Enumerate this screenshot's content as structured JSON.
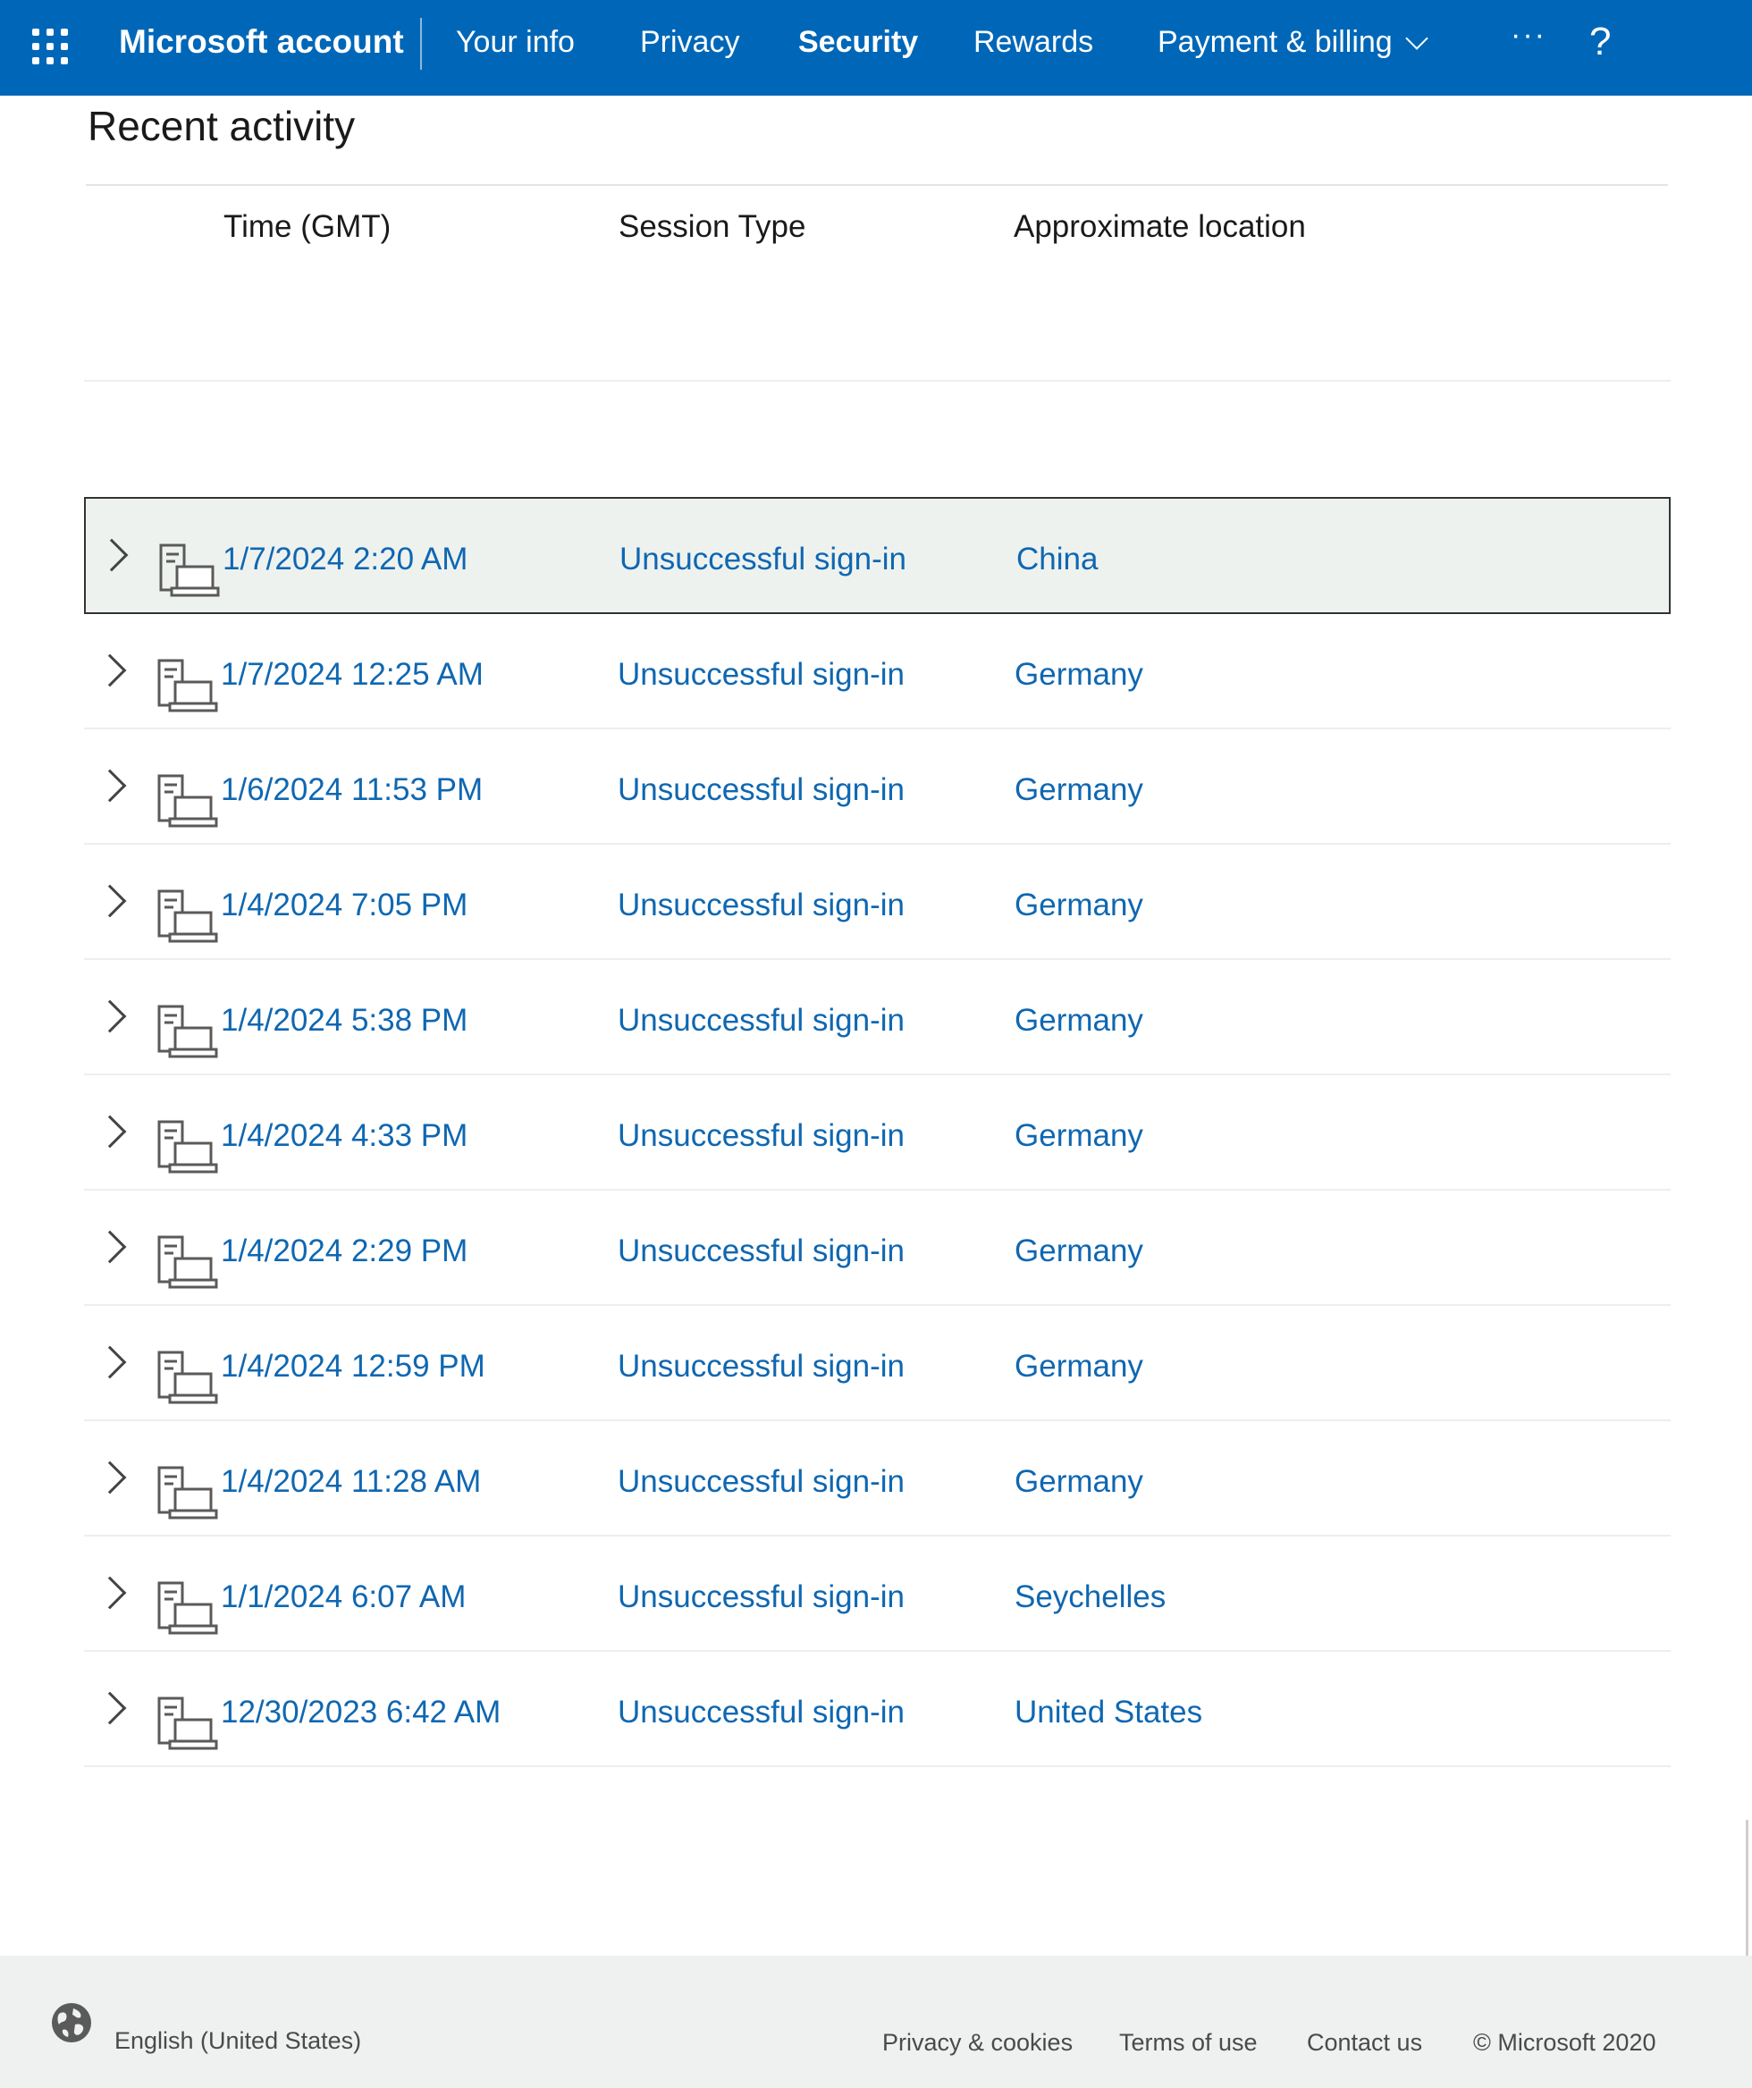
{
  "header": {
    "brand": "Microsoft account",
    "nav": [
      {
        "label": "Your info",
        "active": false
      },
      {
        "label": "Privacy",
        "active": false
      },
      {
        "label": "Security",
        "active": true
      },
      {
        "label": "Rewards",
        "active": false
      },
      {
        "label": "Payment & billing",
        "active": false
      }
    ],
    "more_label": "···",
    "help_label": "?"
  },
  "activity": {
    "title": "Recent activity",
    "columns": {
      "time": "Time (GMT)",
      "type": "Session Type",
      "location": "Approximate location"
    },
    "rows": [
      {
        "time": "1/7/2024 2:20 AM",
        "type": "Unsuccessful sign-in",
        "location": "China",
        "focused": true
      },
      {
        "time": "1/7/2024 12:25 AM",
        "type": "Unsuccessful sign-in",
        "location": "Germany"
      },
      {
        "time": "1/6/2024 11:53 PM",
        "type": "Unsuccessful sign-in",
        "location": "Germany"
      },
      {
        "time": "1/4/2024 7:05 PM",
        "type": "Unsuccessful sign-in",
        "location": "Germany"
      },
      {
        "time": "1/4/2024 5:38 PM",
        "type": "Unsuccessful sign-in",
        "location": "Germany"
      },
      {
        "time": "1/4/2024 4:33 PM",
        "type": "Unsuccessful sign-in",
        "location": "Germany"
      },
      {
        "time": "1/4/2024 2:29 PM",
        "type": "Unsuccessful sign-in",
        "location": "Germany"
      },
      {
        "time": "1/4/2024 12:59 PM",
        "type": "Unsuccessful sign-in",
        "location": "Germany"
      },
      {
        "time": "1/4/2024 11:28 AM",
        "type": "Unsuccessful sign-in",
        "location": "Germany"
      },
      {
        "time": "1/1/2024 6:07 AM",
        "type": "Unsuccessful sign-in",
        "location": "Seychelles"
      },
      {
        "time": "12/30/2023 6:42 AM",
        "type": "Unsuccessful sign-in",
        "location": "United States"
      }
    ]
  },
  "footer": {
    "language": "English (United States)",
    "links": [
      "Privacy & cookies",
      "Terms of use",
      "Contact us"
    ],
    "copyright": "© Microsoft 2020"
  },
  "colors": {
    "header_bg": "#0067b8",
    "link": "#0f67b1",
    "footer_bg": "#eef1ef",
    "focused_row_bg": "#eef2ef"
  },
  "icons": {
    "app_launcher": "waffle-icon",
    "row_expand": "chevron-right-icon",
    "device": "device-icon",
    "language": "globe-icon"
  }
}
